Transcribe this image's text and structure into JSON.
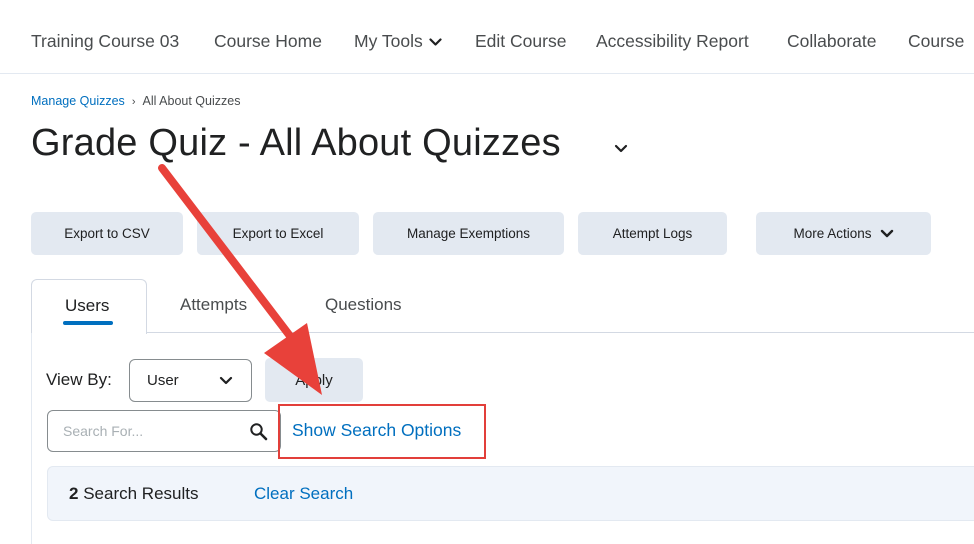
{
  "topnav": {
    "course_title": "Training Course 03",
    "course_home": "Course Home",
    "my_tools": "My Tools",
    "edit_course": "Edit Course",
    "accessibility_report": "Accessibility Report",
    "collaborate": "Collaborate",
    "course_overflow": "Course"
  },
  "breadcrumb": {
    "parent": "Manage Quizzes",
    "current": "All About Quizzes"
  },
  "page": {
    "title": "Grade Quiz - All About Quizzes"
  },
  "actions": {
    "export_csv": "Export to CSV",
    "export_excel": "Export to Excel",
    "manage_exemptions": "Manage Exemptions",
    "attempt_logs": "Attempt Logs",
    "more_actions": "More Actions"
  },
  "tabs": {
    "users": "Users",
    "attempts": "Attempts",
    "questions": "Questions"
  },
  "filters": {
    "view_by_label": "View By:",
    "view_by_value": "User",
    "apply": "Apply",
    "search_placeholder": "Search For...",
    "search_value": "",
    "show_search_options": "Show Search Options"
  },
  "results": {
    "count": "2",
    "count_label": "Search Results",
    "clear_search": "Clear Search"
  },
  "colors": {
    "link": "#006fbf",
    "button_bg": "#e3e9f1",
    "highlight": "#e23f3a",
    "annotation_arrow": "#e8413a"
  },
  "icons": {
    "my_tools_chevron": "chevron-down-icon",
    "title_chevron": "chevron-down-icon",
    "more_actions_chevron": "chevron-down-icon",
    "select_chevron": "chevron-down-icon",
    "search": "search-icon",
    "annotation": "red-arrow-annotation"
  }
}
